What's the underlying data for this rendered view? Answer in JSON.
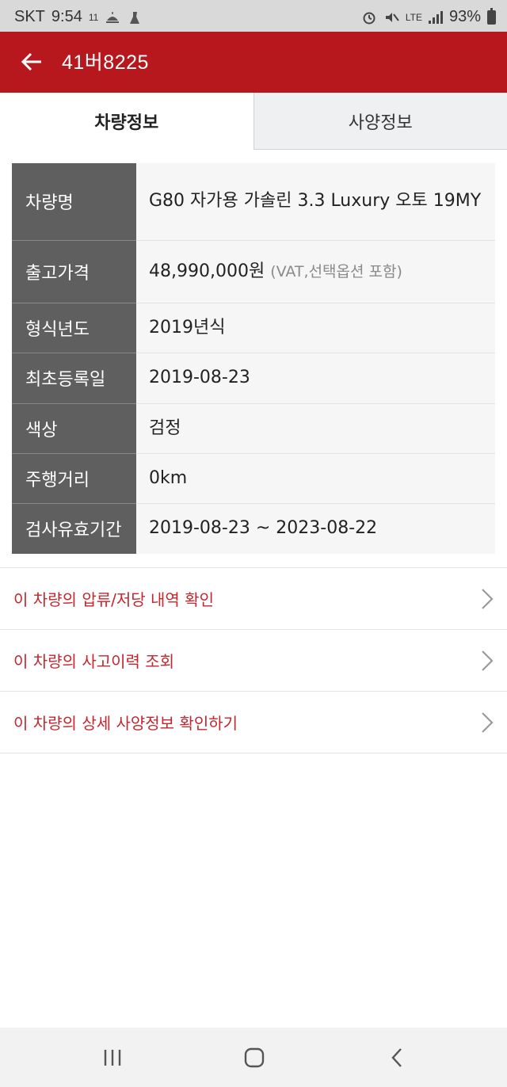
{
  "status_bar": {
    "carrier": "SKT",
    "time": "9:54",
    "temp": "11",
    "network": "LTE",
    "battery_text": "93%",
    "battery_level": 0.93
  },
  "app_bar": {
    "title": "41버8225",
    "back_icon": "arrow-left-icon"
  },
  "tabs": [
    {
      "label": "차량정보",
      "active": true
    },
    {
      "label": "사양정보",
      "active": false
    }
  ],
  "info": {
    "rows": [
      {
        "key": "차량명",
        "value": "G80 자가용 가솔린 3.3 Luxury 오토 19MY",
        "note": ""
      },
      {
        "key": "출고가격",
        "value": "48,990,000원",
        "note": "(VAT,선택옵션 포함)"
      },
      {
        "key": "형식년도",
        "value": "2019년식",
        "note": ""
      },
      {
        "key": "최초등록일",
        "value": "2019-08-23",
        "note": ""
      },
      {
        "key": "색상",
        "value": "검정",
        "note": ""
      },
      {
        "key": "주행거리",
        "value": "0km",
        "note": ""
      },
      {
        "key": "검사유효기간",
        "value": "2019-08-23 ~ 2023-08-22",
        "note": ""
      }
    ]
  },
  "links": [
    {
      "label": "이 차량의 압류/저당 내역 확인"
    },
    {
      "label": "이 차량의 사고이력 조회"
    },
    {
      "label": "이 차량의 상세 사양정보 확인하기"
    }
  ],
  "colors": {
    "brand_red": "#b6181d",
    "link_red": "#c1272d",
    "header_cell": "#5f5f5f"
  },
  "nav_bar": {
    "recent_icon": "recent-apps-icon",
    "home_icon": "home-icon",
    "back_icon": "back-chevron-icon"
  }
}
